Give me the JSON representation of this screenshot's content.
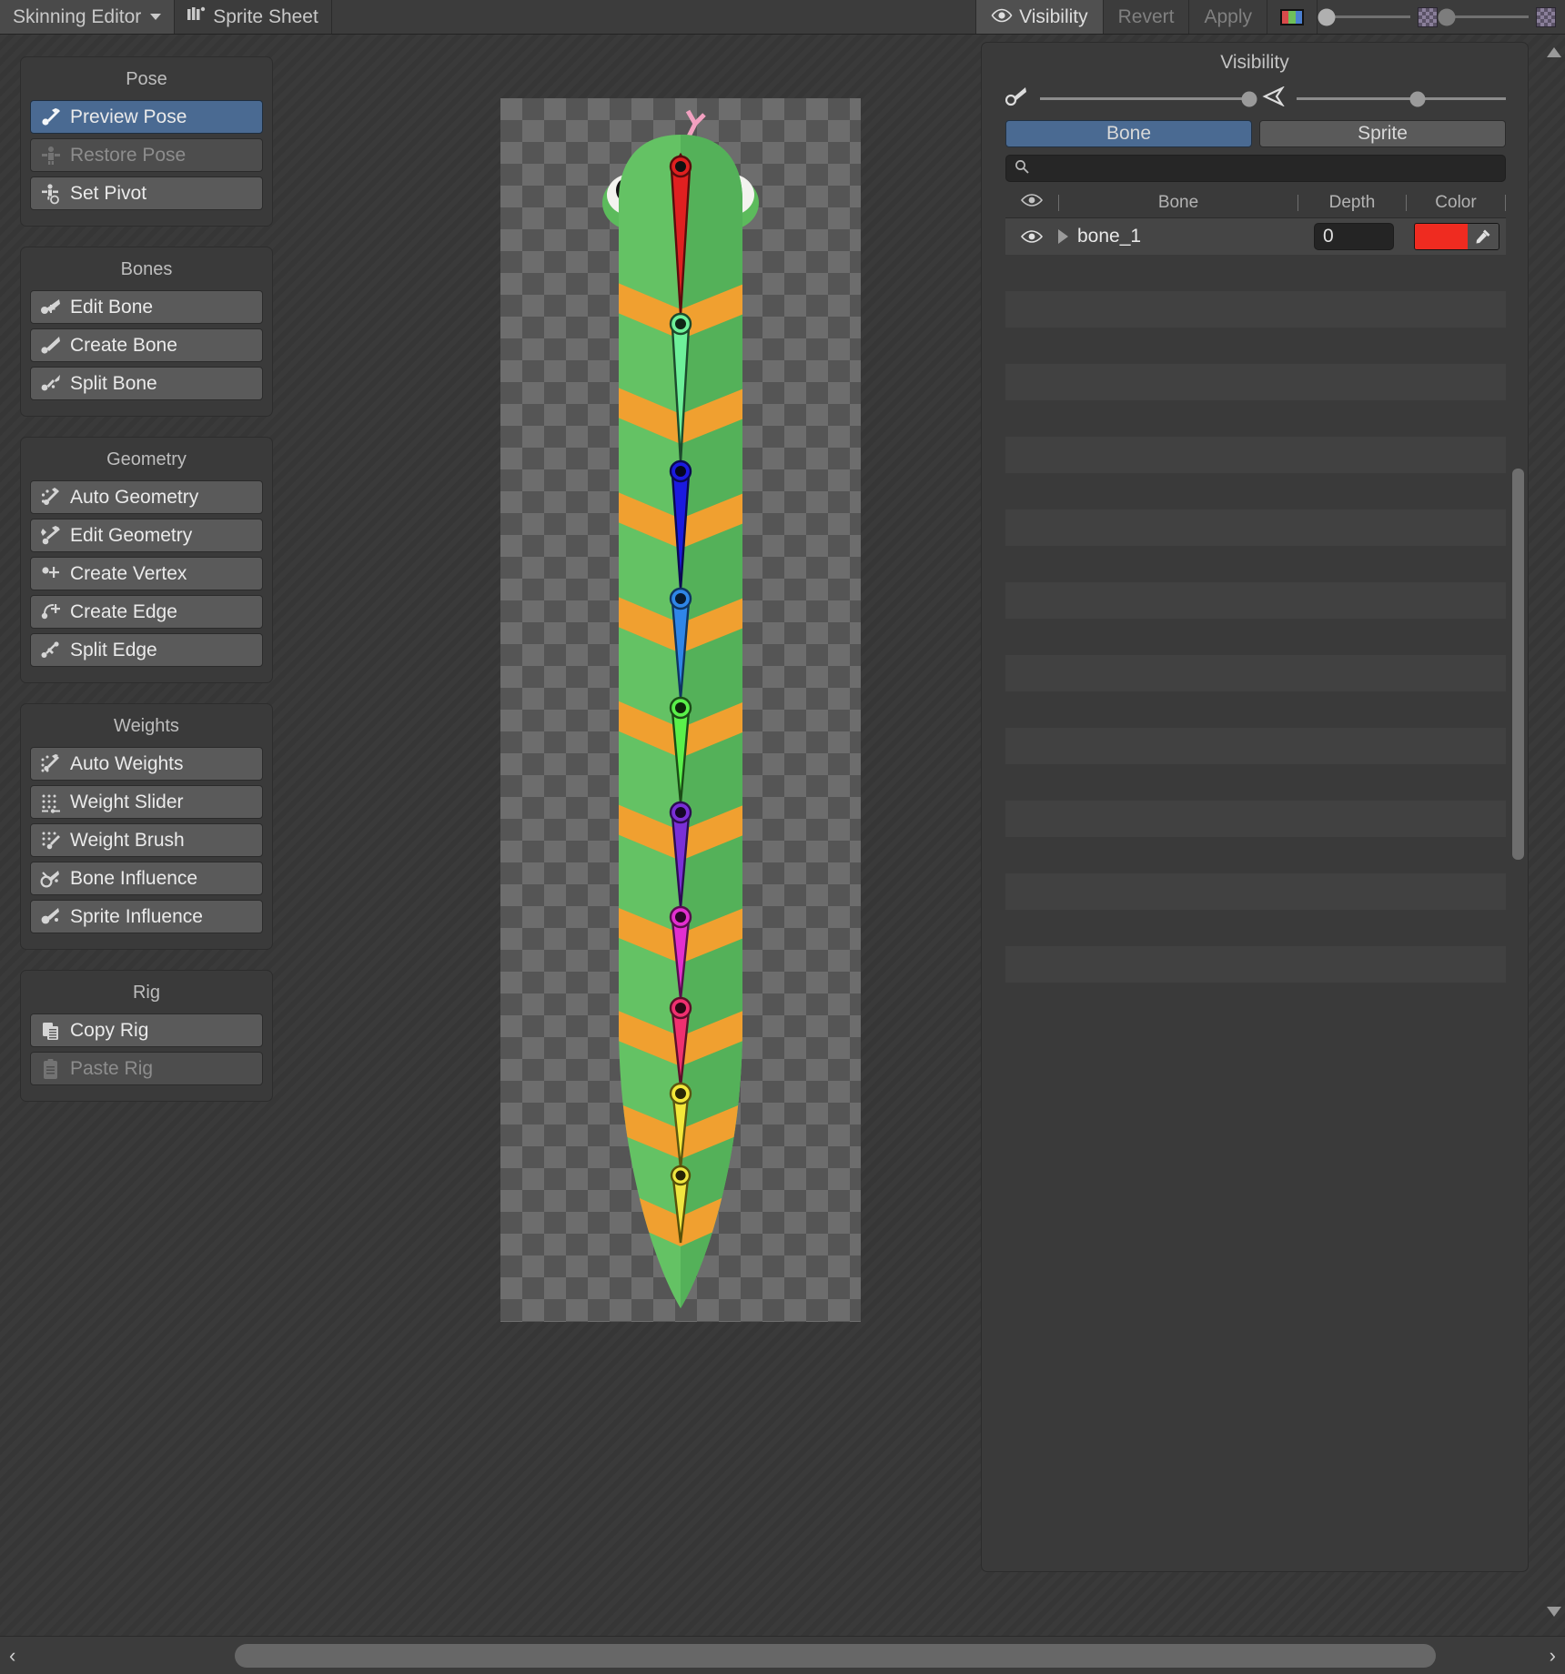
{
  "toolbar": {
    "editor_tab": "Skinning Editor",
    "sprite_sheet_tab": "Sprite Sheet",
    "visibility_label": "Visibility",
    "revert_label": "Revert",
    "apply_label": "Apply",
    "rgb_icon": "rgb-channels-icon",
    "eye_icon": "eye-icon",
    "caret_icon": "chevron-down-icon",
    "sprite_sheet_icon": "sprite-sheet-icon",
    "slider_left_value": 0,
    "slider_right_value": 42,
    "checker_icon": "checkerboard-icon"
  },
  "sidebar": {
    "panels": [
      {
        "title": "Pose",
        "items": [
          {
            "label": "Preview Pose",
            "icon": "preview-pose-icon",
            "state": "selected"
          },
          {
            "label": "Restore Pose",
            "icon": "restore-pose-icon",
            "state": "disabled"
          },
          {
            "label": "Set Pivot",
            "icon": "set-pivot-icon",
            "state": "normal"
          }
        ]
      },
      {
        "title": "Bones",
        "items": [
          {
            "label": "Edit Bone",
            "icon": "edit-bone-icon",
            "state": "normal"
          },
          {
            "label": "Create Bone",
            "icon": "create-bone-icon",
            "state": "normal"
          },
          {
            "label": "Split Bone",
            "icon": "split-bone-icon",
            "state": "normal"
          }
        ]
      },
      {
        "title": "Geometry",
        "items": [
          {
            "label": "Auto Geometry",
            "icon": "auto-geometry-icon",
            "state": "normal"
          },
          {
            "label": "Edit Geometry",
            "icon": "edit-geometry-icon",
            "state": "normal"
          },
          {
            "label": "Create Vertex",
            "icon": "create-vertex-icon",
            "state": "normal"
          },
          {
            "label": "Create Edge",
            "icon": "create-edge-icon",
            "state": "normal"
          },
          {
            "label": "Split Edge",
            "icon": "split-edge-icon",
            "state": "normal"
          }
        ]
      },
      {
        "title": "Weights",
        "items": [
          {
            "label": "Auto Weights",
            "icon": "auto-weights-icon",
            "state": "normal"
          },
          {
            "label": "Weight Slider",
            "icon": "weight-slider-icon",
            "state": "normal"
          },
          {
            "label": "Weight Brush",
            "icon": "weight-brush-icon",
            "state": "normal"
          },
          {
            "label": "Bone Influence",
            "icon": "bone-influence-icon",
            "state": "normal"
          },
          {
            "label": "Sprite Influence",
            "icon": "sprite-influence-icon",
            "state": "normal"
          }
        ]
      },
      {
        "title": "Rig",
        "items": [
          {
            "label": "Copy Rig",
            "icon": "copy-rig-icon",
            "state": "normal"
          },
          {
            "label": "Paste Rig",
            "icon": "paste-rig-icon",
            "state": "disabled"
          }
        ]
      }
    ]
  },
  "visibility": {
    "title": "Visibility",
    "opacity_slider_value": 100,
    "bone_size_slider_value": 60,
    "bone_opacity_icon": "bone-opacity-icon",
    "bone_size_icon": "bone-size-icon",
    "tabs": [
      {
        "label": "Bone",
        "active": true
      },
      {
        "label": "Sprite",
        "active": false
      }
    ],
    "search_placeholder": "",
    "search_value": "",
    "search_icon": "search-icon",
    "columns": [
      "Bone",
      "Depth",
      "Color"
    ],
    "eye_column_icon": "eye-icon",
    "rows": [
      {
        "name": "bone_1",
        "depth": "0",
        "color": "#ef2b20",
        "visible": true,
        "expand_icon": "triangle-right-icon",
        "eye_icon": "eye-icon",
        "eyedropper_icon": "eyedropper-icon"
      }
    ],
    "empty_row_count": 21
  },
  "canvas": {
    "name": "sprite-canvas",
    "background": "checkerboard",
    "sprite_body_color": "#64c264",
    "sprite_body_shade": "#4fae58",
    "sprite_stripe_color": "#f0a030",
    "sprite_tongue_color": "#f5a3c0",
    "eye_white": "#f4f4f2",
    "eye_pupil": "#111111",
    "bone_chain": [
      {
        "index": 1,
        "color": "#e02020"
      },
      {
        "index": 2,
        "color": "#6ef09a"
      },
      {
        "index": 3,
        "color": "#1a1ae0"
      },
      {
        "index": 4,
        "color": "#2f86e8"
      },
      {
        "index": 5,
        "color": "#5af04a"
      },
      {
        "index": 6,
        "color": "#7a2fd8"
      },
      {
        "index": 7,
        "color": "#e32fd0"
      },
      {
        "index": 8,
        "color": "#f03070"
      },
      {
        "index": 9,
        "color": "#f5e83a"
      },
      {
        "index": 10,
        "color": "#f0e640"
      },
      {
        "index": 11,
        "color": "#e87820"
      },
      {
        "index": 12,
        "color": "#e07a1a"
      },
      {
        "index": 13,
        "color": "#7fe03a"
      },
      {
        "index": 14,
        "color": "#6ce8f0"
      },
      {
        "index": 15,
        "color": "#7ce4f0"
      },
      {
        "index": 16,
        "color": "#9ae82a"
      },
      {
        "index": 17,
        "color": "#1a1ae8"
      },
      {
        "index": 18,
        "color": "#e84ae8"
      }
    ]
  },
  "hscrollbar": {
    "name": "horizontal-scrollbar",
    "left_arrow": "‹",
    "right_arrow": "›"
  }
}
